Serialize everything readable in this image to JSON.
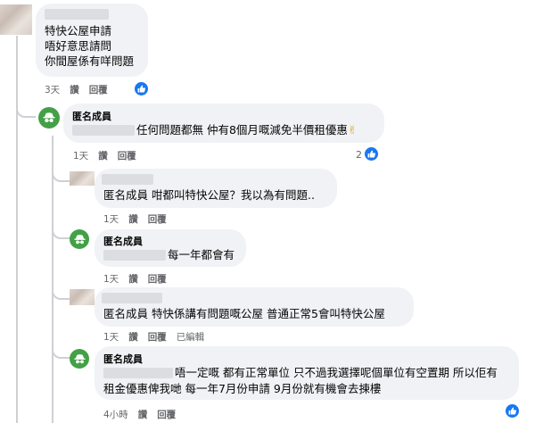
{
  "comments": [
    {
      "author": "",
      "lines": [
        "特快公屋申請",
        "唔好意思請問",
        "你間屋係有咩問題"
      ],
      "time": "3天",
      "like": "讚",
      "reply": "回覆",
      "reaction_icon": "like-icon"
    },
    {
      "author": "匿名成員",
      "text": "任何問題都無 仲有8個月嘅減免半價租優惠",
      "emoji": "✌",
      "time": "1天",
      "like": "讚",
      "reply": "回覆",
      "reaction_count": "2",
      "reaction_icon": "like-icon"
    },
    {
      "author": "",
      "text": "匿名成員 咁都叫特快公屋？我以為有問題..",
      "time": "1天",
      "like": "讚",
      "reply": "回覆"
    },
    {
      "author": "匿名成員",
      "text": "每一年都會有",
      "time": "1天",
      "like": "讚",
      "reply": "回覆"
    },
    {
      "author": "",
      "text": "匿名成員 特快係講有問題嘅公屋 普通正常5會叫特快公屋",
      "time": "1天",
      "like": "讚",
      "reply": "回覆",
      "edited": "已編輯"
    },
    {
      "author": "匿名成員",
      "line1": "唔一定嘅 都有正常單位 只不過我選擇呢個單位有空置期 所以佢有",
      "line2": "租金優惠俾我哋 每一年7月份申請 9月份就有機會去揀樓",
      "time": "4小時",
      "like": "讚",
      "reply": "回覆",
      "reaction_icon": "like-icon"
    }
  ],
  "colors": {
    "bubble": "#f0f2f5",
    "meta": "#65676b",
    "like_blue": "#1877f2",
    "anon_green": "#43a047"
  }
}
